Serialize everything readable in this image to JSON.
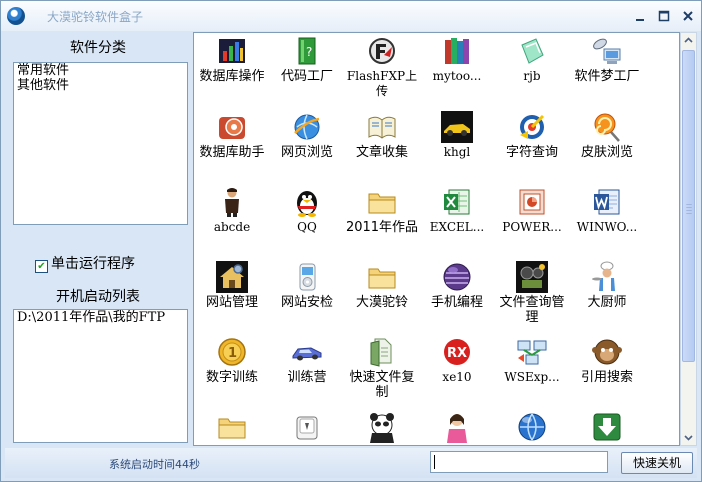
{
  "window": {
    "title": "大漠驼铃软件盒子"
  },
  "left_panel": {
    "category_title": "软件分类",
    "categories": [
      "常用软件",
      "其他软件"
    ],
    "checkbox_label": "单击运行程序",
    "checkbox_checked": true,
    "startup_title": "开机启动列表",
    "startup_items": [
      "D:\\2011年作品\\我的FTP"
    ]
  },
  "grid": {
    "rows": [
      [
        {
          "label": "数据库操作",
          "icon": "database-chart-icon"
        },
        {
          "label": "代码工厂",
          "icon": "green-book-icon"
        },
        {
          "label": "FlashFXP上传",
          "icon": "flashfxp-icon"
        },
        {
          "label": "mytoo...",
          "icon": "books-icon"
        },
        {
          "label": "rjb",
          "icon": "crystal-icon"
        },
        {
          "label": "软件梦工厂",
          "icon": "satellite-computer-icon"
        }
      ],
      [
        {
          "label": "数据库助手",
          "icon": "database-helper-icon"
        },
        {
          "label": "网页浏览",
          "icon": "globe-browser-icon"
        },
        {
          "label": "文章收集",
          "icon": "open-book-icon"
        },
        {
          "label": "khgl",
          "icon": "sports-car-icon"
        },
        {
          "label": "字符查询",
          "icon": "target-arrow-icon"
        },
        {
          "label": "皮肤浏览",
          "icon": "lollipop-icon"
        }
      ],
      [
        {
          "label": "abcde",
          "icon": "person-icon"
        },
        {
          "label": "QQ",
          "icon": "qq-penguin-icon"
        },
        {
          "label": "2011年作品",
          "icon": "folder-icon"
        },
        {
          "label": "EXCEL...",
          "icon": "excel-icon"
        },
        {
          "label": "POWER...",
          "icon": "powerpoint-icon"
        },
        {
          "label": "WINWO...",
          "icon": "word-icon"
        }
      ],
      [
        {
          "label": "网站管理",
          "icon": "house-gear-icon"
        },
        {
          "label": "网站安检",
          "icon": "ipod-icon"
        },
        {
          "label": "大漠驼铃",
          "icon": "folder-icon"
        },
        {
          "label": "手机编程",
          "icon": "purple-orb-icon"
        },
        {
          "label": "文件查询管理",
          "icon": "film-reel-icon"
        },
        {
          "label": "大厨师",
          "icon": "chef-icon"
        }
      ],
      [
        {
          "label": "数字训练",
          "icon": "gold-coin-icon"
        },
        {
          "label": "训练营",
          "icon": "blue-car-icon"
        },
        {
          "label": "快速文件复制",
          "icon": "file-copy-icon"
        },
        {
          "label": "xe10",
          "icon": "rx-badge-icon"
        },
        {
          "label": "WSExp...",
          "icon": "network-computers-icon"
        },
        {
          "label": "引用搜索",
          "icon": "monkey-search-icon"
        }
      ],
      [
        {
          "label": "",
          "icon": "folder-icon"
        },
        {
          "label": "",
          "icon": "keyboard-key-icon"
        },
        {
          "label": "",
          "icon": "panda-icon"
        },
        {
          "label": "",
          "icon": "girl-icon"
        },
        {
          "label": "",
          "icon": "blue-globe-icon"
        },
        {
          "label": "",
          "icon": "download-arrow-icon"
        }
      ]
    ]
  },
  "statusbar": {
    "status_text": "系统启动时间44秒",
    "input_value": "",
    "shutdown_label": "快速关机"
  }
}
